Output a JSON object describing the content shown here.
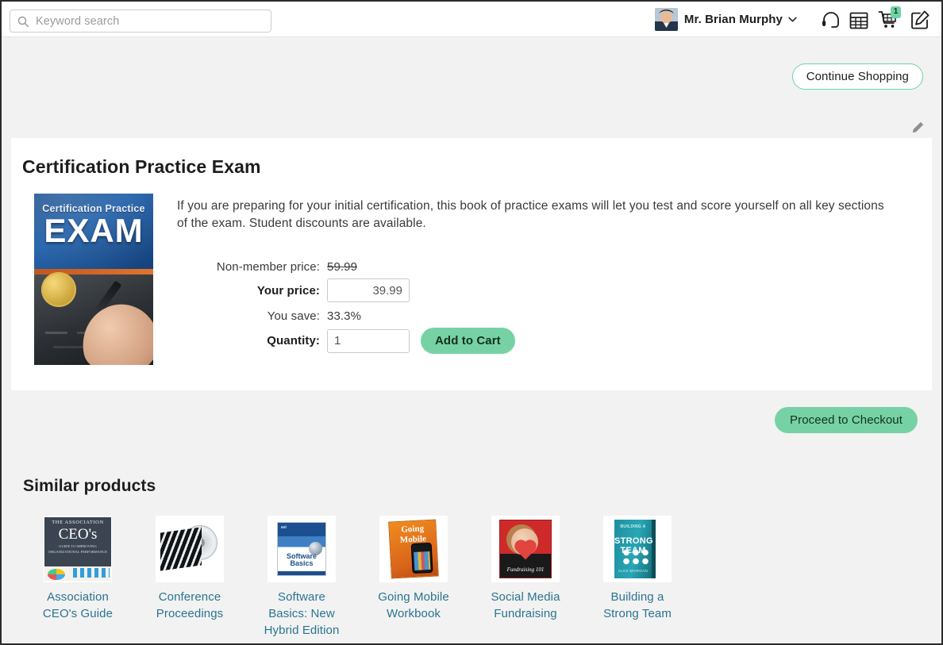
{
  "header": {
    "search": {
      "placeholder": "Keyword search",
      "value": "",
      "icon": "search-icon"
    },
    "user": {
      "name": "Mr. Brian Murphy",
      "avatar_alt": "user-avatar",
      "caret": "chevron-down-icon"
    },
    "icons": [
      {
        "name": "headset-icon",
        "label": "Support"
      },
      {
        "name": "calendar-icon",
        "label": "Calendar"
      },
      {
        "name": "cart-icon",
        "label": "Cart",
        "badge": "1"
      },
      {
        "name": "compose-icon",
        "label": "Compose"
      }
    ]
  },
  "toolbar": {
    "continue_shopping_label": "Continue Shopping",
    "edit_icon": "pencil-icon"
  },
  "product": {
    "title": "Certification Practice Exam",
    "description": "If you are preparing for your initial certification, this book of practice exams will let you test and score yourself on all key sections of the exam. Student discounts are available.",
    "cover": {
      "subtitle": "Certification Practice",
      "main": "EXAM",
      "seal_alt": "gold-seal"
    },
    "pricing": {
      "nonmember_label": "Non-member price:",
      "nonmember_value": "59.99",
      "your_price_label": "Your price:",
      "your_price_value": "39.99",
      "you_save_label": "You save:",
      "you_save_value": "33.3%",
      "quantity_label": "Quantity:",
      "quantity_value": "1",
      "add_to_cart_label": "Add to Cart"
    }
  },
  "checkout": {
    "proceed_label": "Proceed to Checkout"
  },
  "similar": {
    "title": "Similar products",
    "items": [
      {
        "label": "Association CEO's Guide",
        "cover_line1": "THE ASSOCIATION",
        "cover_line2": "CEO's",
        "cover_line3": "GUIDE TO IMPROVING ORGANIZATIONAL PERFORMANCE"
      },
      {
        "label": "Conference Proceedings"
      },
      {
        "label": "Software Basics: New Hybrid Edition",
        "cover_brand": "asi",
        "cover_title": "Software Basics"
      },
      {
        "label": "Going Mobile Workbook",
        "cover_line1": "Going",
        "cover_line2": "Mobile"
      },
      {
        "label": "Social Media Fundraising",
        "cover_caption": "Fundraising 101"
      },
      {
        "label": "Building a Strong Team",
        "cover_line1": "BUILDING A",
        "cover_line2": "STRONG TEAM",
        "cover_author": "ALEX MORGAN"
      }
    ]
  },
  "colors": {
    "accent_green": "#76d2a4",
    "link_blue": "#2b7490",
    "page_bg": "#f2f2f2",
    "card_bg": "#ffffff",
    "text_dark": "#1d1d1d"
  }
}
